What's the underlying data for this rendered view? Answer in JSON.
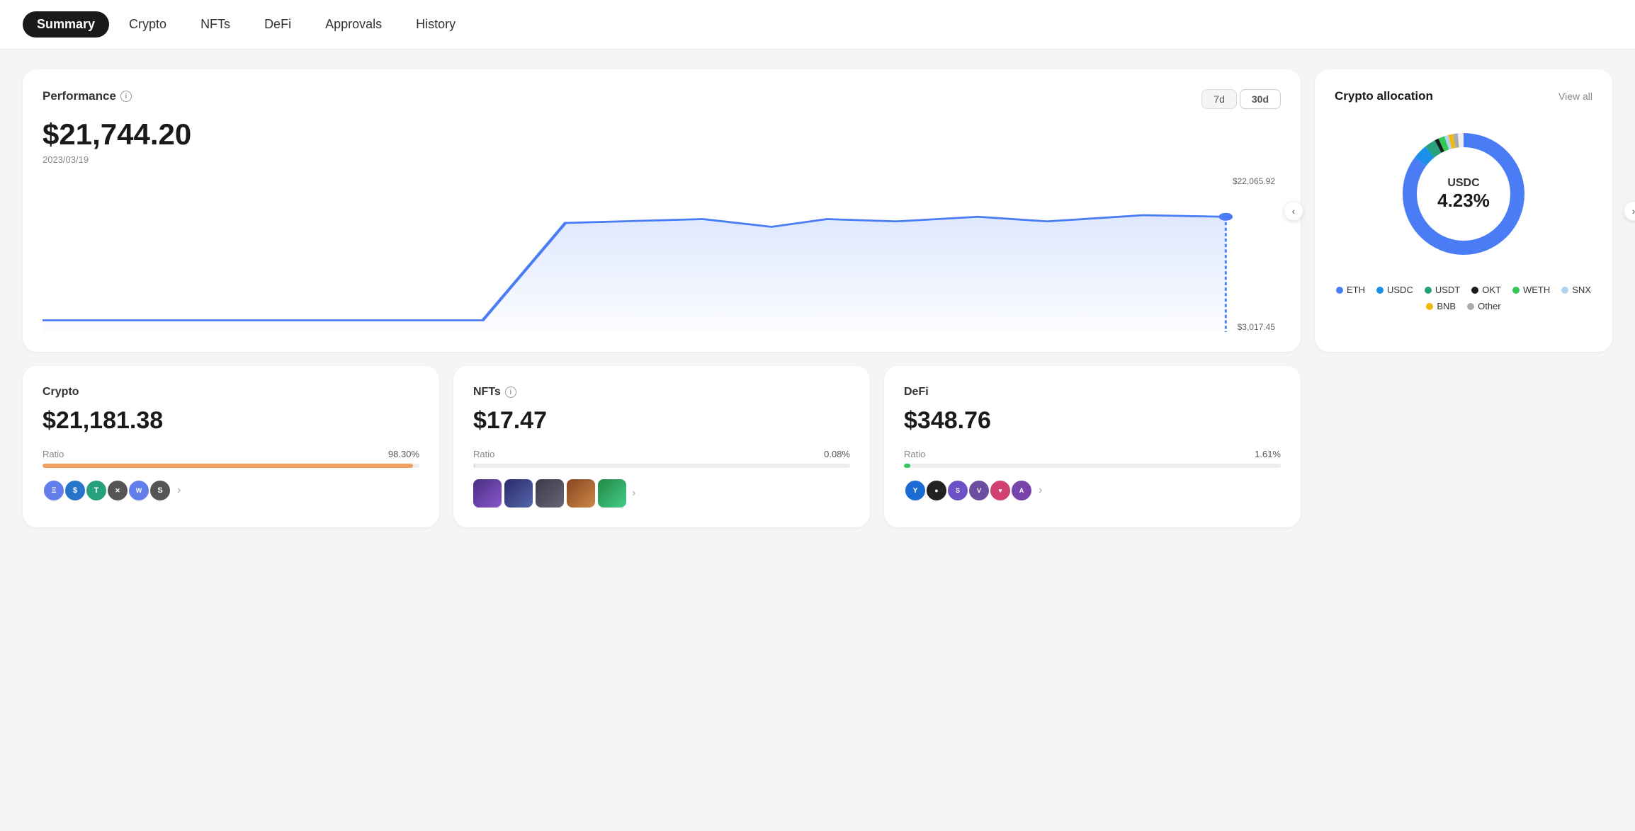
{
  "nav": {
    "items": [
      {
        "label": "Summary",
        "active": true
      },
      {
        "label": "Crypto",
        "active": false
      },
      {
        "label": "NFTs",
        "active": false
      },
      {
        "label": "DeFi",
        "active": false
      },
      {
        "label": "Approvals",
        "active": false
      },
      {
        "label": "History",
        "active": false
      }
    ]
  },
  "performance": {
    "title": "Performance",
    "amount": "$21,744.20",
    "date": "2023/03/19",
    "time_buttons": [
      {
        "label": "7d",
        "active": false
      },
      {
        "label": "30d",
        "active": true
      }
    ],
    "chart_high": "$22,065.92",
    "chart_low": "$3,017.45"
  },
  "allocation": {
    "title": "Crypto allocation",
    "view_all": "View all",
    "center_label": "USDC",
    "center_pct": "4.23%",
    "legend": [
      {
        "label": "ETH",
        "color": "#4a7df5"
      },
      {
        "label": "USDC",
        "color": "#1a90e8"
      },
      {
        "label": "USDT",
        "color": "#26a17b"
      },
      {
        "label": "OKT",
        "color": "#1a1a1a"
      },
      {
        "label": "WETH",
        "color": "#34c759"
      },
      {
        "label": "SNX",
        "color": "#b0d4f0"
      },
      {
        "label": "BNB",
        "color": "#f0b90b"
      },
      {
        "label": "Other",
        "color": "#aaa"
      }
    ]
  },
  "crypto_card": {
    "title": "Crypto",
    "amount": "$21,181.38",
    "ratio_label": "Ratio",
    "ratio_pct": "98.30%",
    "bar_color": "#f0a060",
    "bar_width": 98.3
  },
  "nfts_card": {
    "title": "NFTs",
    "amount": "$17.47",
    "ratio_label": "Ratio",
    "ratio_pct": "0.08%",
    "bar_color": "#ddd",
    "bar_width": 0.08
  },
  "defi_card": {
    "title": "DeFi",
    "amount": "$348.76",
    "ratio_label": "Ratio",
    "ratio_pct": "1.61%",
    "bar_color": "#34c759",
    "bar_width": 1.61
  },
  "arrows": {
    "left": "‹",
    "right": "›"
  }
}
